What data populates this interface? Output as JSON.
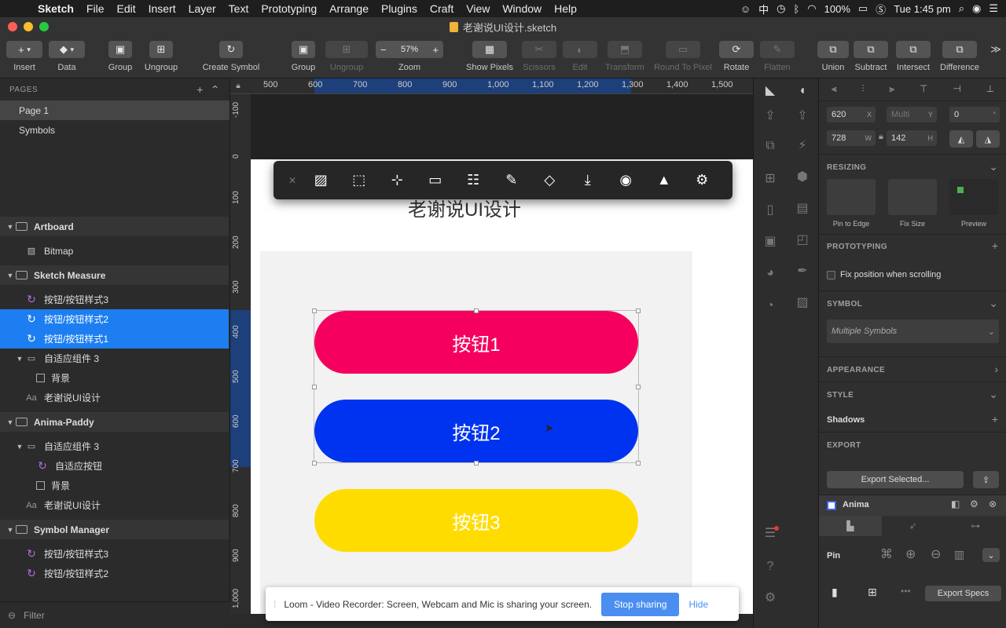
{
  "menubar": {
    "app": "Sketch",
    "items": [
      "File",
      "Edit",
      "Insert",
      "Layer",
      "Text",
      "Prototyping",
      "Arrange",
      "Plugins",
      "Craft",
      "View",
      "Window",
      "Help"
    ],
    "ime": "中",
    "battery": "100%",
    "clock": "Tue 1:45 pm"
  },
  "window": {
    "title": "老谢说UI设计.sketch"
  },
  "toolbar": {
    "insert": "Insert",
    "data": "Data",
    "group": "Group",
    "ungroup": "Ungroup",
    "create_symbol": "Create Symbol",
    "group2": "Group",
    "ungroup2": "Ungroup",
    "zoom_label": "Zoom",
    "zoom_value": "57%",
    "zoom_minus": "−",
    "zoom_plus": "+",
    "show_pixels": "Show Pixels",
    "scissors": "Scissors",
    "edit": "Edit",
    "transform": "Transform",
    "round": "Round To Pixel",
    "rotate": "Rotate",
    "flatten": "Flatten",
    "union": "Union",
    "subtract": "Subtract",
    "intersect": "Intersect",
    "difference": "Difference",
    "insert_glyph": "+",
    "data_glyph": "◆",
    "more": "≫"
  },
  "pages": {
    "header": "PAGES",
    "add": "+",
    "collapse": "⌃",
    "items": [
      "Page 1",
      "Symbols"
    ]
  },
  "layers": [
    {
      "name": "Artboard",
      "kind": "artboard"
    },
    {
      "name": "Bitmap",
      "kind": "bitmap"
    },
    {
      "name": "Sketch Measure",
      "kind": "artboard"
    },
    {
      "name": "按钮/按钮样式3",
      "kind": "symbol"
    },
    {
      "name": "按钮/按钮样式2",
      "kind": "symbol-sel"
    },
    {
      "name": "按钮/按钮样式1",
      "kind": "symbol-sel"
    },
    {
      "name": "自适应组件 3",
      "kind": "group"
    },
    {
      "name": "背景",
      "kind": "rect"
    },
    {
      "name": "老谢说UI设计",
      "kind": "text"
    },
    {
      "name": "Anima-Paddy",
      "kind": "artboard"
    },
    {
      "name": "自适应组件 3",
      "kind": "group"
    },
    {
      "name": "自适应按钮",
      "kind": "symbol"
    },
    {
      "name": "背景",
      "kind": "rect"
    },
    {
      "name": "老谢说UI设计",
      "kind": "text"
    },
    {
      "name": "Symbol Manager",
      "kind": "artboard"
    },
    {
      "name": "按钮/按钮样式3",
      "kind": "symbol"
    },
    {
      "name": "按钮/按钮样式2",
      "kind": "symbol"
    }
  ],
  "filter": {
    "label": "Filter"
  },
  "ruler": {
    "top": [
      "500",
      "600",
      "700",
      "800",
      "900",
      "1,000",
      "1,100",
      "1,200",
      "1,300",
      "1,400",
      "1,500"
    ],
    "left": [
      "-100",
      "0",
      "100",
      "200",
      "300",
      "400",
      "500",
      "600",
      "700",
      "800",
      "900",
      "1,000"
    ]
  },
  "canvas": {
    "artboard_title": "老谢说UI设计",
    "buttons": [
      {
        "label": "按钮1",
        "color": "#f5005e"
      },
      {
        "label": "按钮2",
        "color": "#0033f0"
      },
      {
        "label": "按钮3",
        "color": "#ffdc00"
      }
    ]
  },
  "inspector": {
    "x": "620",
    "x_suffix": "X",
    "y": "Multi",
    "y_suffix": "Y",
    "rotation": "0",
    "rotation_suffix": "°",
    "w": "728",
    "w_suffix": "W",
    "h": "142",
    "h_suffix": "H",
    "resizing": "RESIZING",
    "pin_to_edge": "Pin to Edge",
    "fix_size": "Fix Size",
    "preview": "Preview",
    "prototyping": "PROTOTYPING",
    "fix_position": "Fix position when scrolling",
    "symbol": "SYMBOL",
    "symbol_value": "Multiple Symbols",
    "appearance": "APPEARANCE",
    "style": "STYLE",
    "shadows": "Shadows",
    "export": "EXPORT",
    "export_selected": "Export Selected...",
    "anima": "Anima",
    "pin": "Pin",
    "export_specs": "Export Specs"
  },
  "loom": {
    "message": "Loom - Video Recorder: Screen, Webcam and Mic is sharing your screen.",
    "stop": "Stop sharing",
    "hide": "Hide"
  },
  "colors": {
    "selection": "#1c7ef1",
    "loom_blue": "#4a8ff0"
  }
}
